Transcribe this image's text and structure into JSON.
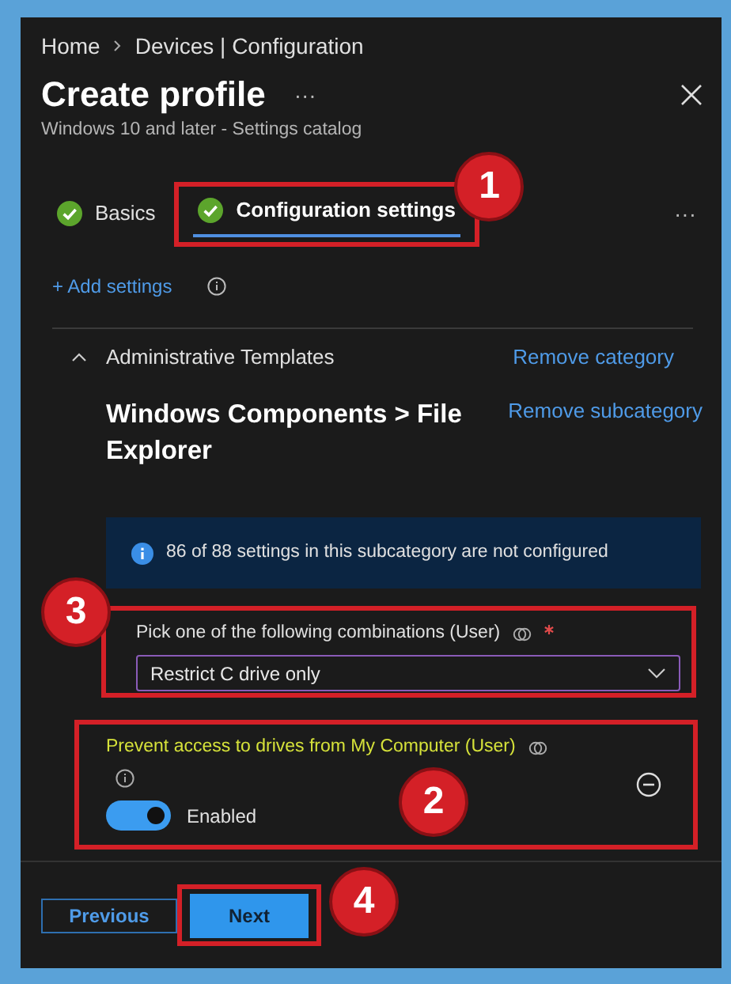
{
  "breadcrumb": [
    "Home",
    "Devices | Configuration"
  ],
  "title": "Create profile",
  "title_more": "···",
  "subtitle": "Windows 10 and later - Settings catalog",
  "tabs": [
    {
      "label": "Basics",
      "selected": false,
      "completed": true
    },
    {
      "label": "Configuration settings",
      "selected": true,
      "completed": true,
      "callout": "1"
    }
  ],
  "tabs_more": "···",
  "add_settings": "+ Add settings",
  "category": {
    "name": "Administrative Templates",
    "expanded": true,
    "remove": "Remove category"
  },
  "subcategory": {
    "name": "Windows Components > File Explorer",
    "remove": "Remove subcategory"
  },
  "info": "86 of 88 settings in this subcategory are not configured",
  "settings": [
    {
      "kind": "dropdown",
      "label": "Pick one of the following combinations (User)",
      "required": true,
      "value": "Restrict C drive only",
      "callout": "3"
    },
    {
      "kind": "toggle",
      "label": "Prevent access to drives from My Computer (User)",
      "on": true,
      "state_label": "Enabled",
      "callout": "2"
    }
  ],
  "buttons": [
    {
      "label": "Previous",
      "kind": "secondary"
    },
    {
      "label": "Next",
      "kind": "primary",
      "callout": "4"
    }
  ]
}
